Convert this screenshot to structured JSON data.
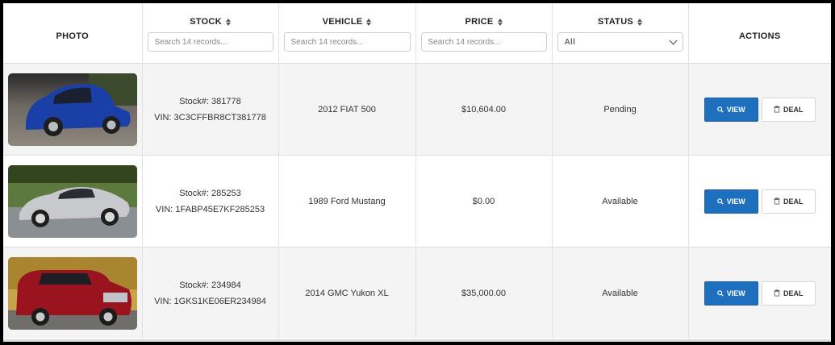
{
  "columns": {
    "photo": "PHOTO",
    "stock": "STOCK",
    "vehicle": "VEHICLE",
    "price": "PRICE",
    "status": "STATUS",
    "actions": "ACTIONS"
  },
  "filters": {
    "stock_placeholder": "Search 14 records...",
    "vehicle_placeholder": "Search 14 records...",
    "price_placeholder": "Search 14 records...",
    "status_selected": "All"
  },
  "rows": [
    {
      "stock": "Stock#: 381778",
      "vin": "VIN: 3C3CFFBR8CT381778",
      "vehicle": "2012 FIAT 500",
      "price": "$10,604.00",
      "status": "Pending",
      "view_label": "VIEW",
      "deal_label": "DEAL"
    },
    {
      "stock": "Stock#: 285253",
      "vin": "VIN: 1FABP45E7KF285253",
      "vehicle": "1989 Ford Mustang",
      "price": "$0.00",
      "status": "Available",
      "view_label": "VIEW",
      "deal_label": "DEAL"
    },
    {
      "stock": "Stock#: 234984",
      "vin": "VIN: 1GKS1KE06ER234984",
      "vehicle": "2014 GMC Yukon XL",
      "price": "$35,000.00",
      "status": "Available",
      "view_label": "VIEW",
      "deal_label": "DEAL"
    }
  ],
  "icons": {
    "sort": "sort-icon",
    "view": "magnifier-icon",
    "deal": "trash-icon",
    "select": "chevron-down-icon"
  },
  "colors": {
    "view_button": "#1f6fbf",
    "car_blue": "#1a3fa6",
    "car_silver": "#c8c9cc",
    "car_red": "#9a1420"
  }
}
